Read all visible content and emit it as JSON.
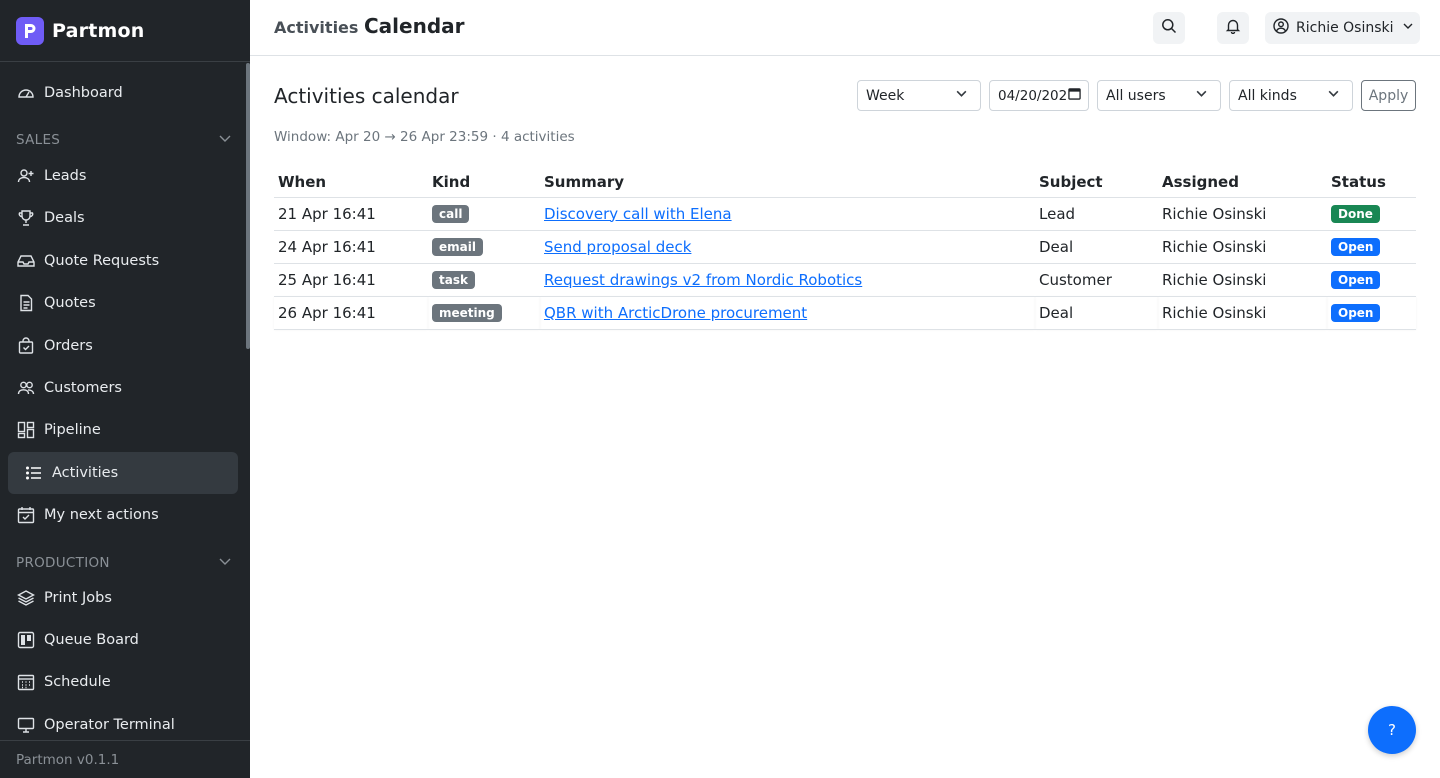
{
  "brand": {
    "name": "Partmon",
    "logo_letter": "P",
    "logo_color": "#6f5cf6"
  },
  "sidebar": {
    "items": [
      {
        "label": "Dashboard",
        "icon": "speedometer-icon"
      },
      {
        "label": "Leads",
        "icon": "person-add-icon"
      },
      {
        "label": "Deals",
        "icon": "trophy-icon"
      },
      {
        "label": "Quote Requests",
        "icon": "inbox-icon"
      },
      {
        "label": "Quotes",
        "icon": "file-text-icon"
      },
      {
        "label": "Orders",
        "icon": "bag-check-icon"
      },
      {
        "label": "Customers",
        "icon": "people-icon"
      },
      {
        "label": "Pipeline",
        "icon": "kanban-icon"
      },
      {
        "label": "Activities",
        "icon": "list-icon",
        "active": true
      },
      {
        "label": "My next actions",
        "icon": "calendar-check-icon"
      },
      {
        "label": "Print Jobs",
        "icon": "layers-icon"
      },
      {
        "label": "Queue Board",
        "icon": "board-icon"
      },
      {
        "label": "Schedule",
        "icon": "calendar-grid-icon"
      },
      {
        "label": "Operator Terminal",
        "icon": "display-icon"
      }
    ],
    "sections": {
      "sales": "SALES",
      "production": "PRODUCTION"
    },
    "footer": "Partmon v0.1.1"
  },
  "header": {
    "breadcrumb": "Activities",
    "title": "Calendar",
    "user_name": "Richie Osinski"
  },
  "main": {
    "title": "Activities calendar",
    "filters": {
      "view": "Week",
      "date": "04/20/202",
      "users": "All users",
      "kinds": "All kinds",
      "apply_label": "Apply"
    },
    "window_info": "Window: Apr 20 → 26 Apr 23:59 · 4 activities",
    "table": {
      "columns": [
        "When",
        "Kind",
        "Summary",
        "Subject",
        "Assigned",
        "Status"
      ],
      "rows": [
        {
          "when": "21 Apr 16:41",
          "kind": "call",
          "summary": "Discovery call with Elena",
          "subject": "Lead",
          "assigned": "Richie Osinski",
          "status": "Done"
        },
        {
          "when": "24 Apr 16:41",
          "kind": "email",
          "summary": "Send proposal deck",
          "subject": "Deal",
          "assigned": "Richie Osinski",
          "status": "Open"
        },
        {
          "when": "25 Apr 16:41",
          "kind": "task",
          "summary": "Request drawings v2 from Nordic Robotics",
          "subject": "Customer",
          "assigned": "Richie Osinski",
          "status": "Open"
        },
        {
          "when": "26 Apr 16:41",
          "kind": "meeting",
          "summary": "QBR with ArcticDrone procurement",
          "subject": "Deal",
          "assigned": "Richie Osinski",
          "status": "Open"
        }
      ]
    }
  },
  "help": {
    "label": "?"
  },
  "colors": {
    "sidebar_bg": "#212529",
    "accent": "#0d6efd",
    "done": "#198754",
    "kind_badge": "#6c757d"
  }
}
